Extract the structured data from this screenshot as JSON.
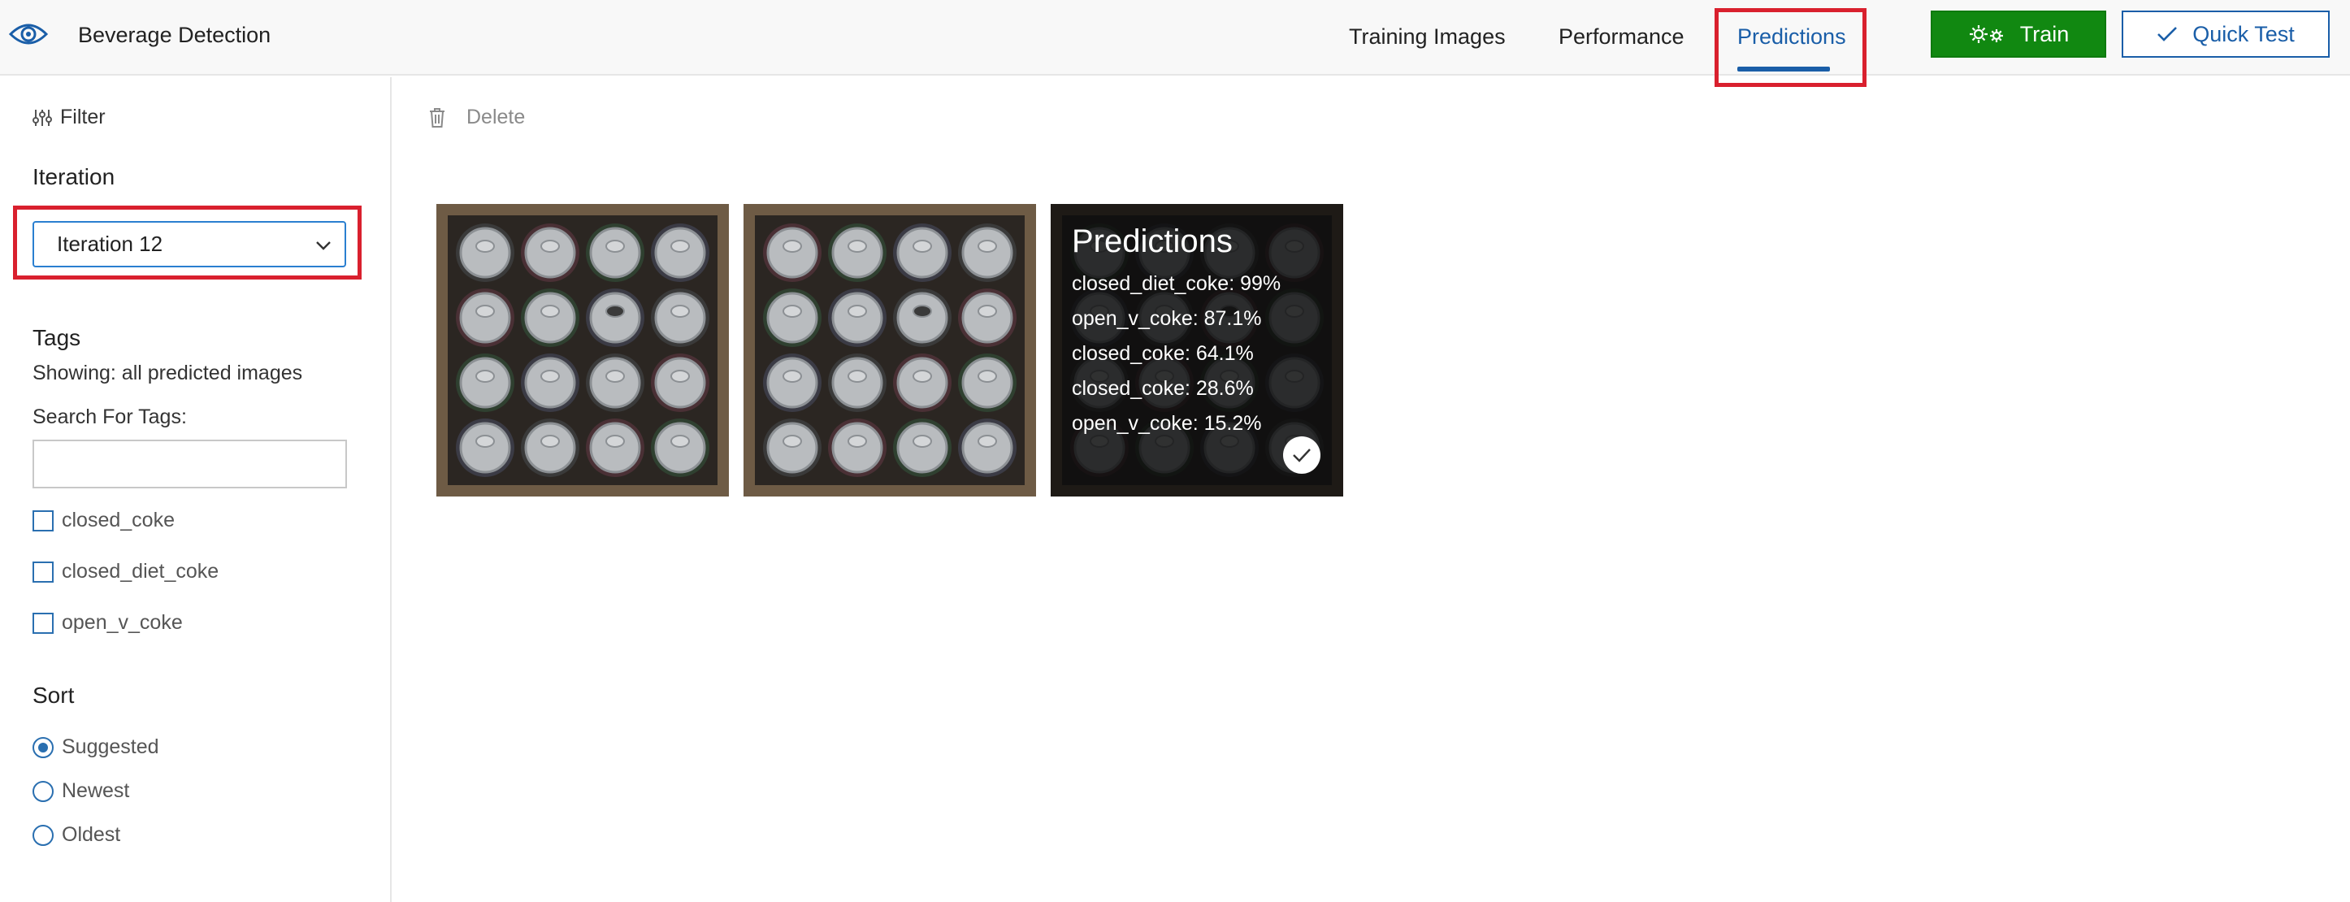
{
  "header": {
    "app_title": "Beverage Detection",
    "logo_icon": "eye-icon",
    "tabs": [
      {
        "label": "Training Images",
        "active": false
      },
      {
        "label": "Performance",
        "active": false
      },
      {
        "label": "Predictions",
        "active": true
      }
    ],
    "train_label": "Train",
    "quick_test_label": "Quick Test"
  },
  "sidebar": {
    "filter_label": "Filter",
    "iteration_title": "Iteration",
    "iteration_selected": "Iteration 12",
    "tags_title": "Tags",
    "showing_text": "Showing: all predicted images",
    "search_label": "Search For Tags:",
    "search_value": "",
    "tags": [
      "closed_coke",
      "closed_diet_coke",
      "open_v_coke"
    ],
    "sort_title": "Sort",
    "sort_options": [
      "Suggested",
      "Newest",
      "Oldest"
    ],
    "sort_selected": "Suggested"
  },
  "main": {
    "delete_label": "Delete",
    "predictions_title": "Predictions",
    "predictions": [
      "closed_diet_coke: 99%",
      "open_v_coke: 87.1%",
      "closed_coke: 64.1%",
      "closed_coke: 28.6%",
      "open_v_coke: 15.2%"
    ]
  },
  "colors": {
    "accent": "#1a5ea8",
    "train_green": "#118811",
    "highlight_red": "#d9202e"
  }
}
